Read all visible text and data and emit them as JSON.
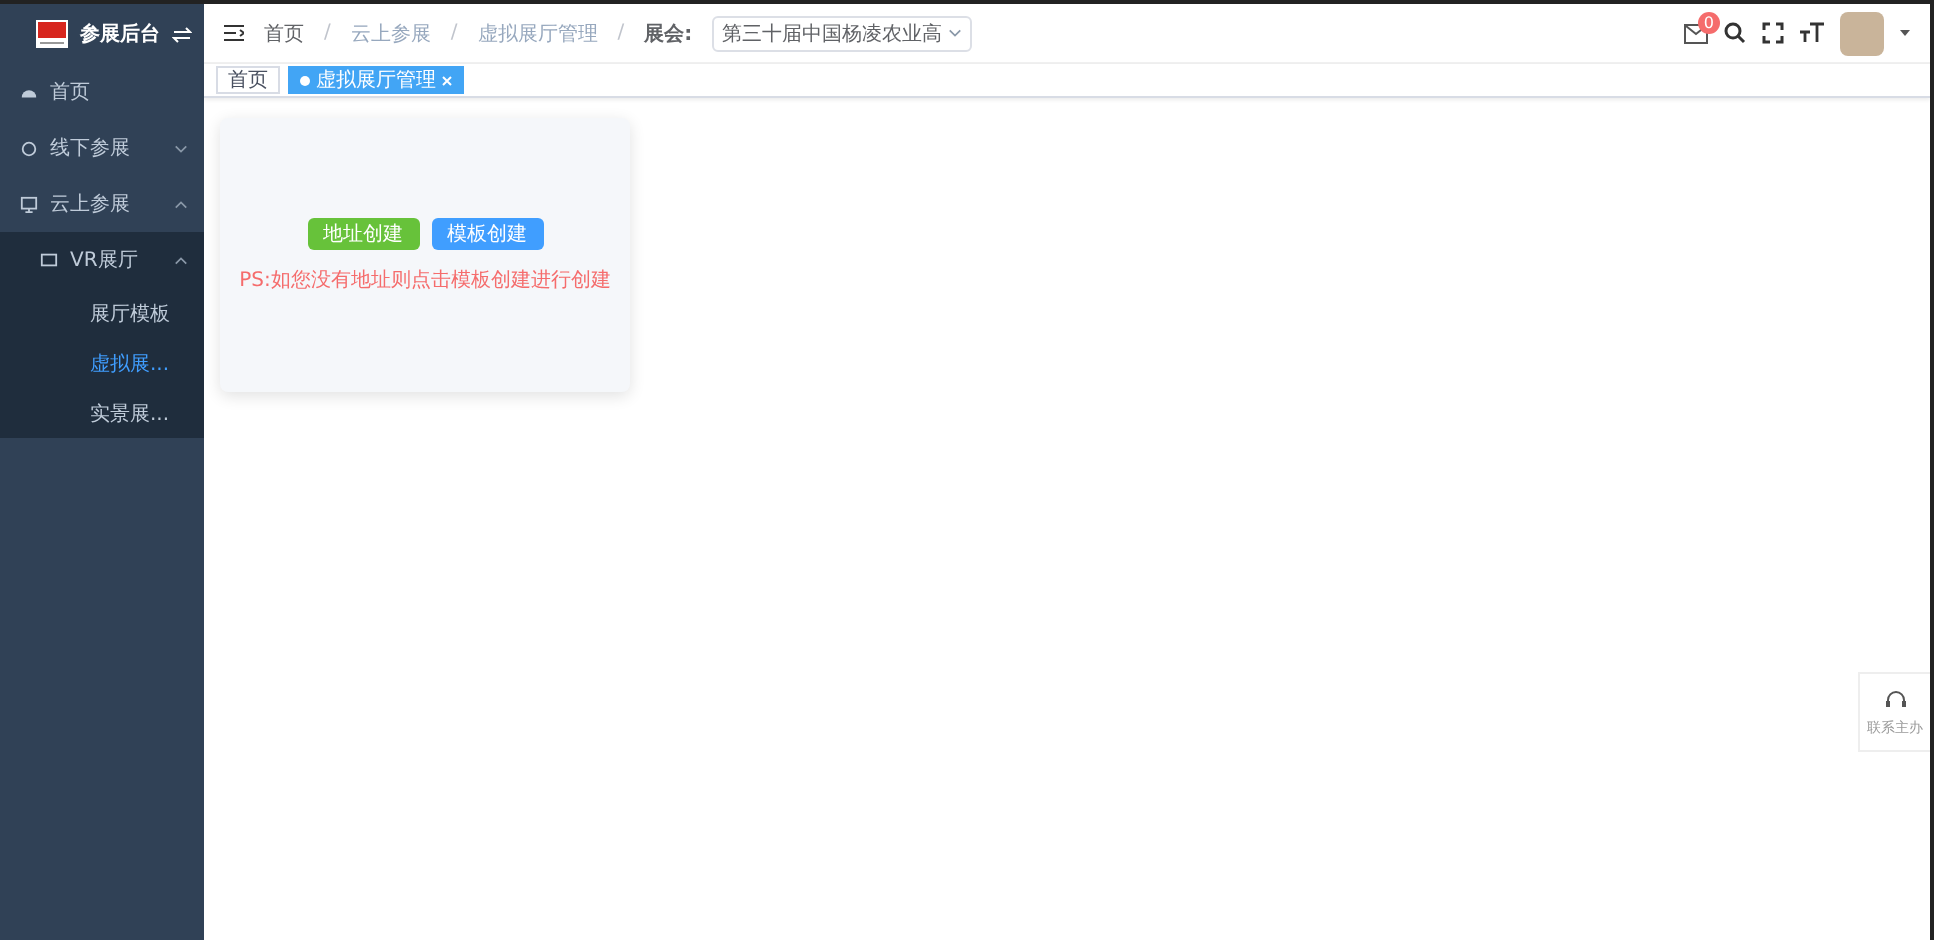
{
  "brand": {
    "title": "参展后台"
  },
  "menu": [
    {
      "label": "首页",
      "selected": false
    },
    {
      "label": "线下参展",
      "expanded": false,
      "selected": false
    },
    {
      "label": "云上参展",
      "expanded": true,
      "selected": false,
      "children": [
        {
          "label": "VR展厅",
          "expanded": true,
          "selected": false,
          "children": [
            {
              "label": "展厅模板",
              "selected": false
            },
            {
              "label": "虚拟展...",
              "selected": true
            },
            {
              "label": "实景展...",
              "selected": false
            }
          ]
        }
      ]
    }
  ],
  "breadcrumb": [
    "首页",
    "云上参展",
    "虚拟展厅管理"
  ],
  "breadcrumb_separator": "/",
  "exhibition": {
    "label": "展会:",
    "value": "第三十届中国杨凌农业高"
  },
  "header": {
    "message_count": "0"
  },
  "tags": [
    {
      "label": "首页",
      "selected": false
    },
    {
      "label": "虚拟展厅管理",
      "selected": true
    }
  ],
  "card": {
    "buttons": [
      {
        "label": "地址创建",
        "kind": "success"
      },
      {
        "label": "模板创建",
        "kind": "primary"
      }
    ],
    "hint": "PS:如您没有地址则点击模板创建进行创建"
  },
  "contact": {
    "label": "联系主办"
  }
}
